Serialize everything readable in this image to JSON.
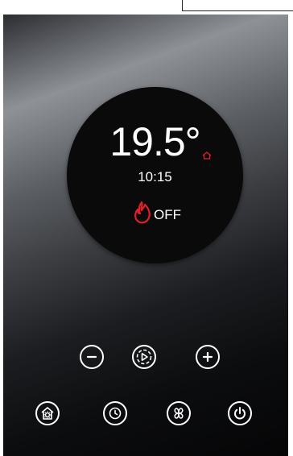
{
  "display": {
    "temperature": "19.5°",
    "time": "10:15",
    "heating_status": "OFF"
  },
  "colors": {
    "accent_red": "#e0202a",
    "text": "#ffffff",
    "screen": "#0a0a0b"
  },
  "icons": {
    "mode": "home-icon",
    "flame": "flame-icon",
    "decrease": "minus-icon",
    "program": "play-icon",
    "increase": "plus-icon",
    "settings": "house-settings-icon",
    "schedule": "clock-icon",
    "fan": "fan-icon",
    "power": "power-icon"
  }
}
